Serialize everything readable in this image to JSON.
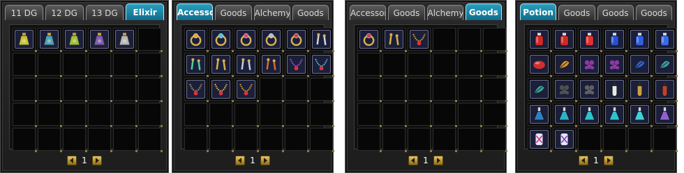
{
  "panels": [
    {
      "tabs": [
        "11 DG",
        "12 DG",
        "13 DG",
        "Elixir"
      ],
      "active_tab": 3,
      "page": "1",
      "items": [
        {
          "slot": 0,
          "icon": "elixir-potion-icon",
          "color": "#c9c43a"
        },
        {
          "slot": 1,
          "icon": "elixir-potion-icon",
          "color": "#4fa3b8"
        },
        {
          "slot": 2,
          "icon": "elixir-potion-icon",
          "color": "#9fbf3a"
        },
        {
          "slot": 3,
          "icon": "elixir-potion-icon",
          "color": "#7f5fb0"
        },
        {
          "slot": 4,
          "icon": "elixir-potion-icon",
          "color": "#b7b7b7"
        }
      ]
    },
    {
      "tabs": [
        "Accessory",
        "Goods",
        "Alchemy",
        "Goods"
      ],
      "active_tab": 0,
      "page": "1",
      "items": [
        {
          "slot": 0,
          "icon": "ring-icon",
          "color": "#d8a545"
        },
        {
          "slot": 1,
          "icon": "ring-icon",
          "color": "#4fc0d0"
        },
        {
          "slot": 2,
          "icon": "ring-icon",
          "color": "#d04f7a"
        },
        {
          "slot": 3,
          "icon": "ring-icon",
          "color": "#bcbcbc"
        },
        {
          "slot": 4,
          "icon": "ring-icon",
          "color": "#d04040"
        },
        {
          "slot": 5,
          "icon": "earring-icon",
          "color": "#cfd7e0"
        },
        {
          "slot": 6,
          "icon": "earring-icon",
          "color": "#4fd0a0"
        },
        {
          "slot": 7,
          "icon": "earring-icon",
          "color": "#d8b04a"
        },
        {
          "slot": 8,
          "icon": "earring-icon",
          "color": "#c8c8e8"
        },
        {
          "slot": 9,
          "icon": "earring-icon",
          "color": "#d86a30"
        },
        {
          "slot": 10,
          "icon": "necklace-icon",
          "color": "#a050e0"
        },
        {
          "slot": 11,
          "icon": "necklace-icon",
          "color": "#4fc0c0"
        },
        {
          "slot": 12,
          "icon": "necklace-icon",
          "color": "#b09060"
        },
        {
          "slot": 13,
          "icon": "necklace-icon",
          "color": "#e0c040"
        },
        {
          "slot": 14,
          "icon": "necklace-icon",
          "color": "#e0a020"
        }
      ]
    },
    {
      "tabs": [
        "Accessory",
        "Goods",
        "Alchemy",
        "Goods"
      ],
      "active_tab": 3,
      "page": "1",
      "items": [
        {
          "slot": 0,
          "icon": "ring-icon",
          "color": "#c04050"
        },
        {
          "slot": 1,
          "icon": "earring-icon",
          "color": "#d8b04a"
        },
        {
          "slot": 2,
          "icon": "necklace-icon",
          "color": "#e0a020"
        }
      ]
    },
    {
      "tabs": [
        "Potion",
        "Goods",
        "Goods",
        "Goods"
      ],
      "active_tab": 0,
      "page": "1",
      "items": [
        {
          "slot": 0,
          "icon": "hp-potion-icon",
          "color": "#d02828"
        },
        {
          "slot": 1,
          "icon": "hp-potion-icon",
          "color": "#d02828"
        },
        {
          "slot": 2,
          "icon": "hp-potion-icon",
          "color": "#e03030"
        },
        {
          "slot": 3,
          "icon": "mp-potion-icon",
          "color": "#2850d0"
        },
        {
          "slot": 4,
          "icon": "mp-potion-icon",
          "color": "#3060e0"
        },
        {
          "slot": 5,
          "icon": "mp-potion-icon",
          "color": "#3a6ae8"
        },
        {
          "slot": 6,
          "icon": "pill-icon",
          "color": "#d03030"
        },
        {
          "slot": 7,
          "icon": "herb-icon",
          "color": "#d8902a"
        },
        {
          "slot": 8,
          "icon": "grape-icon",
          "color": "#8a3aa0"
        },
        {
          "slot": 9,
          "icon": "grape-icon",
          "color": "#8a3aa0"
        },
        {
          "slot": 10,
          "icon": "herb-icon",
          "color": "#3060d0"
        },
        {
          "slot": 11,
          "icon": "herb-icon",
          "color": "#3aa0a0"
        },
        {
          "slot": 12,
          "icon": "herb-icon",
          "color": "#3aa0a0"
        },
        {
          "slot": 13,
          "icon": "grape-icon",
          "color": "#505050"
        },
        {
          "slot": 14,
          "icon": "grape-icon",
          "color": "#606060"
        },
        {
          "slot": 15,
          "icon": "vial-icon",
          "color": "#e8e8e8"
        },
        {
          "slot": 16,
          "icon": "vial-icon",
          "color": "#c8a040"
        },
        {
          "slot": 17,
          "icon": "vial-icon",
          "color": "#c04030"
        },
        {
          "slot": 18,
          "icon": "flask-icon",
          "color": "#3080c0"
        },
        {
          "slot": 19,
          "icon": "flask-icon",
          "color": "#30b0c8"
        },
        {
          "slot": 20,
          "icon": "flask-icon",
          "color": "#30c0d0"
        },
        {
          "slot": 21,
          "icon": "flask-icon",
          "color": "#30c0d0"
        },
        {
          "slot": 22,
          "icon": "flask-icon",
          "color": "#40d0d8"
        },
        {
          "slot": 23,
          "icon": "flask-icon",
          "color": "#9060d0"
        },
        {
          "slot": 24,
          "icon": "scroll-icon",
          "color": "#c04090"
        },
        {
          "slot": 25,
          "icon": "scroll-icon",
          "color": "#8040c0"
        }
      ]
    }
  ]
}
